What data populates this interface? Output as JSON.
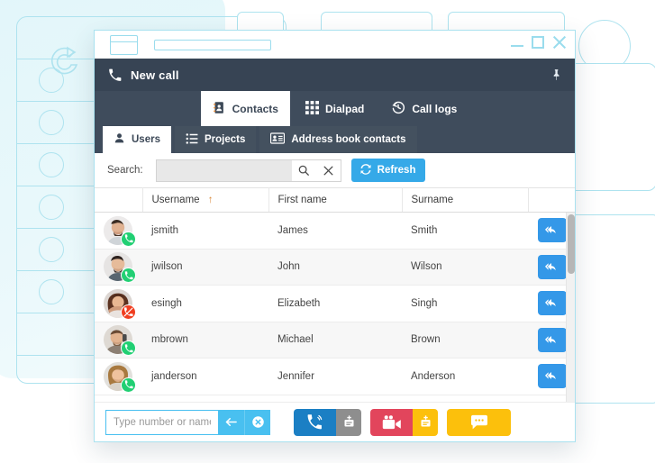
{
  "window": {
    "title": "New call",
    "title_icon": "phone-icon",
    "pin_icon": "pin-icon",
    "minimize_label": "Minimize",
    "maximize_label": "Maximize",
    "close_label": "Close"
  },
  "toolbar": {
    "items": [
      {
        "label": "Contacts",
        "icon": "address-book-icon",
        "active": true
      },
      {
        "label": "Dialpad",
        "icon": "grid-dialpad-icon",
        "active": false
      },
      {
        "label": "Call logs",
        "icon": "history-clock-icon",
        "active": false
      }
    ]
  },
  "subtabs": {
    "items": [
      {
        "label": "Users",
        "icon": "user-icon",
        "active": true
      },
      {
        "label": "Projects",
        "icon": "checklist-icon",
        "active": false
      },
      {
        "label": "Address book contacts",
        "icon": "contact-card-icon",
        "active": false
      }
    ]
  },
  "search": {
    "label": "Search:",
    "value": "",
    "placeholder": "",
    "search_icon": "magnifier-icon",
    "clear_icon": "close-x-icon",
    "refresh_label": "Refresh",
    "refresh_icon": "refresh-icon"
  },
  "table": {
    "columns": [
      {
        "key": "avatar",
        "label": ""
      },
      {
        "key": "username",
        "label": "Username",
        "sort": "↑"
      },
      {
        "key": "firstname",
        "label": "First name"
      },
      {
        "key": "surname",
        "label": "Surname"
      },
      {
        "key": "action",
        "label": ""
      }
    ],
    "rows": [
      {
        "username": "jsmith",
        "firstname": "James",
        "surname": "Smith",
        "status": "available",
        "action_icon": "callback-icon"
      },
      {
        "username": "jwilson",
        "firstname": "John",
        "surname": "Wilson",
        "status": "available",
        "action_icon": "callback-icon"
      },
      {
        "username": "esingh",
        "firstname": "Elizabeth",
        "surname": "Singh",
        "status": "unavailable",
        "action_icon": "callback-icon"
      },
      {
        "username": "mbrown",
        "firstname": "Michael",
        "surname": "Brown",
        "status": "available",
        "action_icon": "callback-icon"
      },
      {
        "username": "janderson",
        "firstname": "Jennifer",
        "surname": "Anderson",
        "status": "available",
        "action_icon": "callback-icon"
      }
    ]
  },
  "dial": {
    "placeholder": "Type number or name",
    "value": "",
    "backspace_icon": "backspace-arrow-icon",
    "clear_icon": "clear-circle-icon"
  },
  "actions": {
    "buttons": [
      {
        "name": "audio-call",
        "icon": "phone-call-icon",
        "color": "#1b7fc4"
      },
      {
        "name": "audio-call-add",
        "icon": "add-participant-icon",
        "color": "#8e8e8e"
      },
      {
        "name": "video-call",
        "icon": "video-camera-icon",
        "color": "#e2455c"
      },
      {
        "name": "video-call-add",
        "icon": "add-participant-icon",
        "color": "#fcc00c"
      },
      {
        "name": "chat",
        "icon": "chat-bubble-icon",
        "color": "#fcc00c"
      }
    ]
  },
  "colors": {
    "titlebar": "#374454",
    "toolbar": "#3f4c5c",
    "accent_blue": "#35a9e8",
    "action_blue": "#3498e8",
    "status_online": "#21cf73",
    "status_offline": "#f03e20",
    "outline_cyan": "#aee3ef"
  }
}
